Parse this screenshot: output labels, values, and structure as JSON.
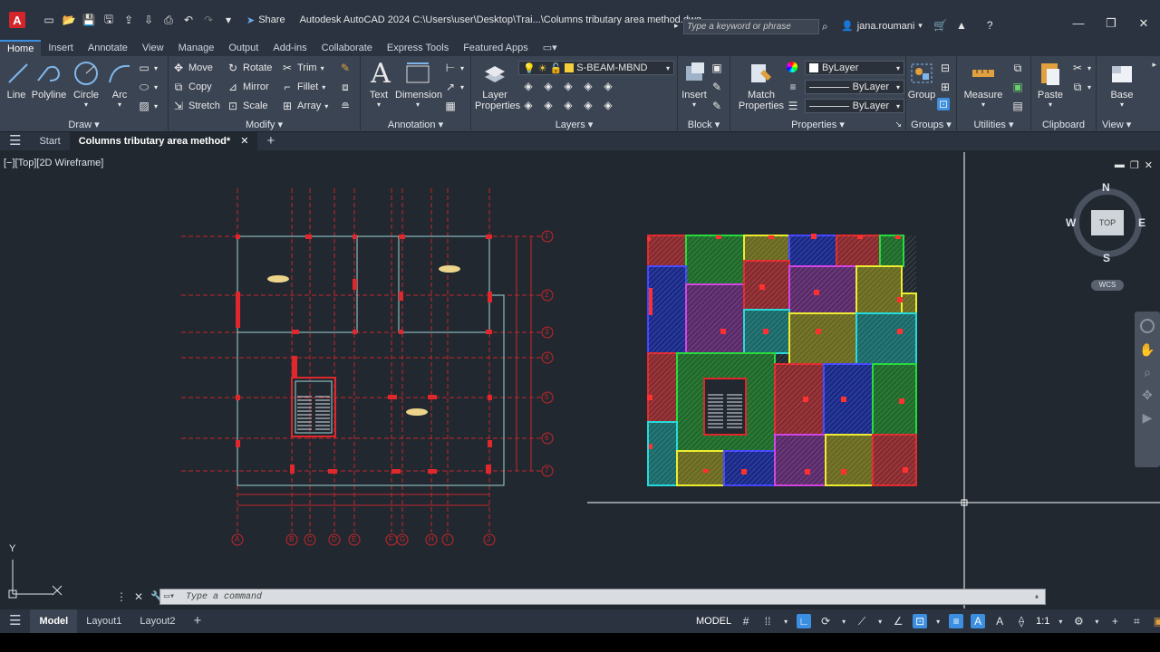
{
  "titlebar": {
    "app_logo": "A",
    "share_label": "Share",
    "title": "Autodesk AutoCAD 2024   C:\\Users\\user\\Desktop\\Trai...\\Columns tributary area method.dwg",
    "search_placeholder": "Type a keyword or phrase",
    "user_name": "jana.roumani"
  },
  "ribbon_tabs": [
    "Home",
    "Insert",
    "Annotate",
    "View",
    "Manage",
    "Output",
    "Add-ins",
    "Collaborate",
    "Express Tools",
    "Featured Apps"
  ],
  "ribbon": {
    "draw": {
      "title": "Draw",
      "line": "Line",
      "polyline": "Polyline",
      "circle": "Circle",
      "arc": "Arc"
    },
    "modify": {
      "title": "Modify",
      "move": "Move",
      "rotate": "Rotate",
      "trim": "Trim",
      "copy": "Copy",
      "mirror": "Mirror",
      "fillet": "Fillet",
      "stretch": "Stretch",
      "scale": "Scale",
      "array": "Array"
    },
    "annotation": {
      "title": "Annotation",
      "text": "Text",
      "dimension": "Dimension"
    },
    "layers": {
      "title": "Layers",
      "layer_properties_1": "Layer",
      "layer_properties_2": "Properties",
      "current_layer": "S-BEAM-MBND"
    },
    "block": {
      "title": "Block",
      "insert": "Insert"
    },
    "properties": {
      "title": "Properties",
      "match_1": "Match",
      "match_2": "Properties",
      "color": "ByLayer",
      "linetype": "ByLayer",
      "lineweight": "ByLayer"
    },
    "groups": {
      "title": "Groups",
      "group": "Group"
    },
    "utilities": {
      "title": "Utilities",
      "measure": "Measure"
    },
    "clipboard": {
      "title": "Clipboard",
      "paste": "Paste"
    },
    "view": {
      "title": "View",
      "base": "Base"
    }
  },
  "filetabs": {
    "start": "Start",
    "current": "Columns tributary area method*"
  },
  "viewport": {
    "label": "[−][Top][2D Wireframe]",
    "viewcube": {
      "n": "N",
      "s": "S",
      "e": "E",
      "w": "W",
      "top": "TOP",
      "wcs": "WCS"
    },
    "grid_rows": [
      "1",
      "2",
      "3",
      "4",
      "5",
      "6",
      "7"
    ],
    "grid_cols": [
      "A",
      "B",
      "C",
      "D",
      "E",
      "F",
      "G",
      "H",
      "I",
      "J"
    ],
    "ucs_y": "Y"
  },
  "command": {
    "placeholder": "Type a command"
  },
  "statusbar": {
    "model_tab": "Model",
    "layout1": "Layout1",
    "layout2": "Layout2",
    "model_label": "MODEL",
    "scale": "1:1"
  },
  "colors": {
    "accent": "#3b8ee0",
    "background": "#212830",
    "grid_red": "#c8262a"
  }
}
